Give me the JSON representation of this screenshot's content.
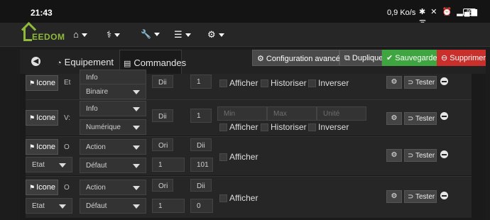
{
  "status": {
    "time": "21:43",
    "speed": "0,9 Ko/s",
    "icons": "✱ ✕ ⏰ ▂▄▆ ᯤ",
    "battery": "86"
  },
  "nav": {
    "logo_text": "EEDOM",
    "menus": [
      {
        "icon": "⌂",
        "name": "home-menu"
      },
      {
        "icon": "⚕",
        "name": "analysis-menu"
      },
      {
        "icon": "🔧",
        "name": "tools-menu"
      },
      {
        "icon": "☰",
        "name": "plugins-menu"
      },
      {
        "icon": "⚙",
        "name": "settings-menu"
      }
    ]
  },
  "tabs": {
    "equipement": "Equipement",
    "commandes": "Commandes"
  },
  "actions": {
    "config": "Configuration avancée",
    "duplicate": "Dupliquer",
    "save": "Sauvegarder",
    "delete": "Supprimer"
  },
  "colors": {
    "save": "#3fa540",
    "delete": "#c9302c",
    "config": "#4a4a4a",
    "logo": "#8fb93d"
  },
  "commands": [
    {
      "icone": "Icone",
      "name_cut": "Et",
      "type": "Info",
      "subtype": "Binaire",
      "unit_a": "Dii",
      "value": "1",
      "afficher": "Afficher",
      "historiser": "Historiser",
      "inverser": "Inverser",
      "tester": "Tester"
    },
    {
      "icone": "Icone",
      "name_cut": "V:",
      "type": "Info",
      "subtype": "Numérique",
      "unit_a": "Dii",
      "value": "1",
      "min": "Min",
      "max": "Max",
      "unite": "Unité",
      "afficher": "Afficher",
      "historiser": "Historiser",
      "inverser": "Inverser",
      "tester": "Tester"
    },
    {
      "icone": "Icone",
      "name_cut": "O",
      "etat": "Etat",
      "type": "Action",
      "subtype": "Défaut",
      "unit_a": "Ori",
      "unit_b": "Dii",
      "val_a": "1",
      "val_b": "101",
      "afficher": "Afficher",
      "tester": "Tester"
    },
    {
      "icone": "Icone",
      "name_cut": "O",
      "etat": "Etat",
      "type": "Action",
      "subtype": "Défaut",
      "unit_a": "Ori",
      "unit_b": "Dii",
      "val_a": "1",
      "val_b": "0",
      "afficher": "Afficher",
      "tester": "Tester"
    }
  ]
}
